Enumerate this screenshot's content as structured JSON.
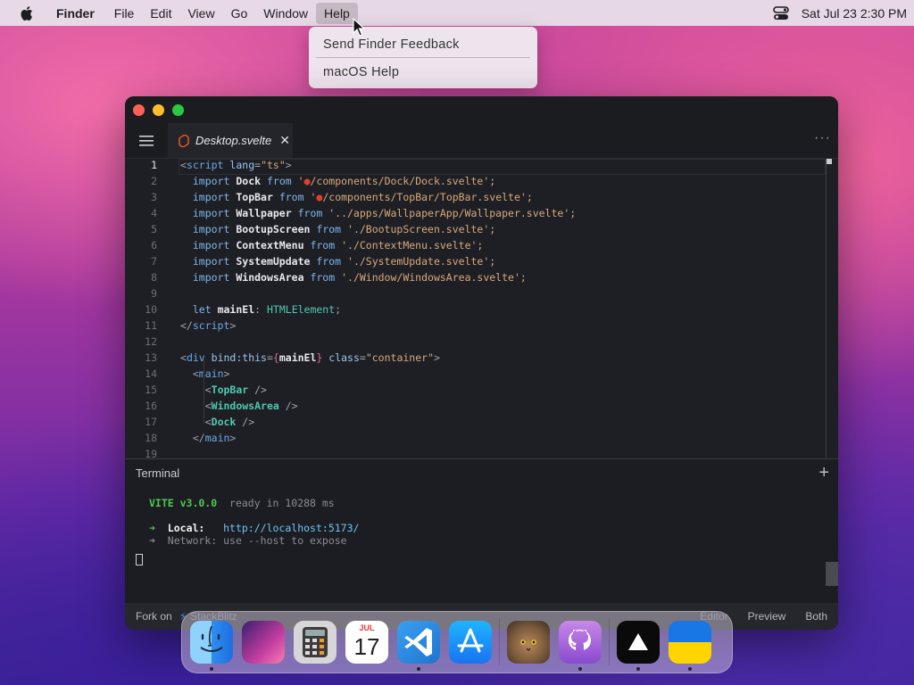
{
  "menubar": {
    "app_name": "Finder",
    "menus": [
      "File",
      "Edit",
      "View",
      "Go",
      "Window",
      "Help"
    ],
    "active_menu": "Help",
    "clock": "Sat Jul 23  2:30 PM"
  },
  "help_menu": {
    "items": [
      "Send Finder Feedback",
      "macOS Help"
    ]
  },
  "editor": {
    "tab_label": "Desktop.svelte",
    "line_numbers": [
      "1",
      "2",
      "3",
      "4",
      "5",
      "6",
      "7",
      "8",
      "9",
      "10",
      "11",
      "12",
      "13",
      "14",
      "15",
      "16",
      "17",
      "18",
      "19"
    ],
    "lines": [
      [
        "<",
        "script",
        " ",
        "lang",
        "=",
        "\"ts\"",
        ">"
      ],
      [
        "import",
        "Dock",
        "from",
        "'",
        "/components/Dock/Dock.svelte';"
      ],
      [
        "import",
        "TopBar",
        "from",
        "'",
        "/components/TopBar/TopBar.svelte';"
      ],
      [
        "import",
        "Wallpaper",
        "from",
        "'../apps/WallpaperApp/Wallpaper.svelte';"
      ],
      [
        "import",
        "BootupScreen",
        "from",
        "'./BootupScreen.svelte';"
      ],
      [
        "import",
        "ContextMenu",
        "from",
        "'./ContextMenu.svelte';"
      ],
      [
        "import",
        "SystemUpdate",
        "from",
        "'./SystemUpdate.svelte';"
      ],
      [
        "import",
        "WindowsArea",
        "from",
        "'./Window/WindowsArea.svelte';"
      ],
      [],
      [
        "let",
        "mainEl",
        ":",
        "HTMLElement",
        ";"
      ],
      [
        "</",
        "script",
        ">"
      ],
      [],
      [
        "<",
        "div",
        "bind:this",
        "=",
        "{",
        "mainEl",
        "}",
        "class",
        "=",
        "\"container\"",
        ">"
      ],
      [
        "<",
        "main",
        ">"
      ],
      [
        "<",
        "TopBar",
        " />"
      ],
      [
        "<",
        "WindowsArea",
        " />"
      ],
      [
        "<",
        "Dock",
        " />"
      ],
      [
        "</",
        "main",
        ">"
      ],
      []
    ]
  },
  "terminal": {
    "title": "Terminal",
    "vite_label": "VITE v3.0.0",
    "ready_text": "ready in 10288 ms",
    "arrow": "➜",
    "local_label": "Local:",
    "local_url": "http://localhost:5173/",
    "network_label": "Network:",
    "network_text": "use --host to expose"
  },
  "statusbar": {
    "fork_label": "Fork on",
    "stackblitz": "StackBlitz",
    "editor_label": "Editor",
    "preview_label": "Preview",
    "both_label": "Both"
  },
  "dock": {
    "calendar_month": "JUL",
    "calendar_day": "17",
    "apps": [
      "finder",
      "launchpad",
      "calculator",
      "calendar",
      "vscode",
      "app-store",
      "cat",
      "github",
      "vercel",
      "ukraine"
    ]
  }
}
